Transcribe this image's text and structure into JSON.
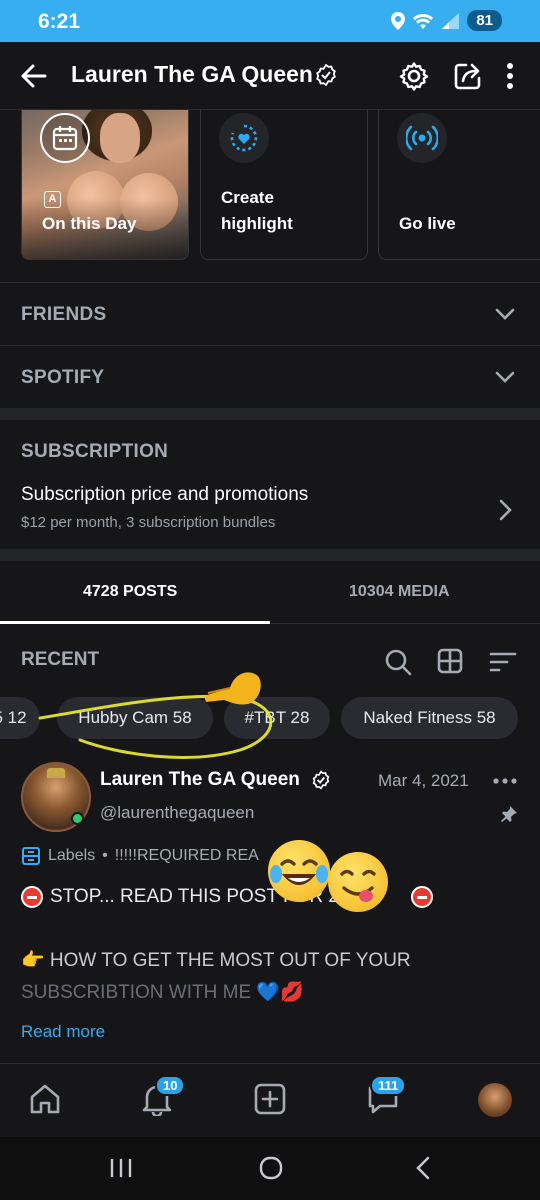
{
  "status_bar": {
    "time": "6:21",
    "battery": "81"
  },
  "header": {
    "title": "Lauren The GA Queen"
  },
  "highlights": [
    {
      "label": "On this Day",
      "badge": "A"
    },
    {
      "label_line1": "Create",
      "label_line2": "highlight"
    },
    {
      "label": "Go live"
    }
  ],
  "sections": {
    "friends": "FRIENDS",
    "spotify": "SPOTIFY",
    "subscription": "SUBSCRIPTION"
  },
  "subscription": {
    "title": "Subscription price and promotions",
    "desc": "$12 per month, 3 subscription bundles"
  },
  "tabs": {
    "posts": "4728 POSTS",
    "media": "10304 MEDIA"
  },
  "recent_label": "RECENT",
  "chips": [
    "5 12",
    "Hubby Cam 58",
    "#TBT 28",
    "Naked Fitness 58"
  ],
  "post": {
    "name": "Lauren The GA Queen",
    "date": "Mar 4, 2021",
    "handle": "@laurenthegaqueen",
    "labels": "Labels",
    "labels_value": "!!!!!REQUIRED REA",
    "line1": "STOP... READ THIS POST FOR 2",
    "line2": "👉 HOW TO GET THE MOST OUT OF YOUR",
    "line3": "SUBSCRIBTION WITH ME 💙💋",
    "read_more": "Read more"
  },
  "nav": {
    "notifications_badge": "10",
    "messages_badge": "111"
  },
  "colors": {
    "accent": "#36aef0",
    "link": "#39aaf0",
    "background": "#161618",
    "annotation": "#f0f030"
  }
}
